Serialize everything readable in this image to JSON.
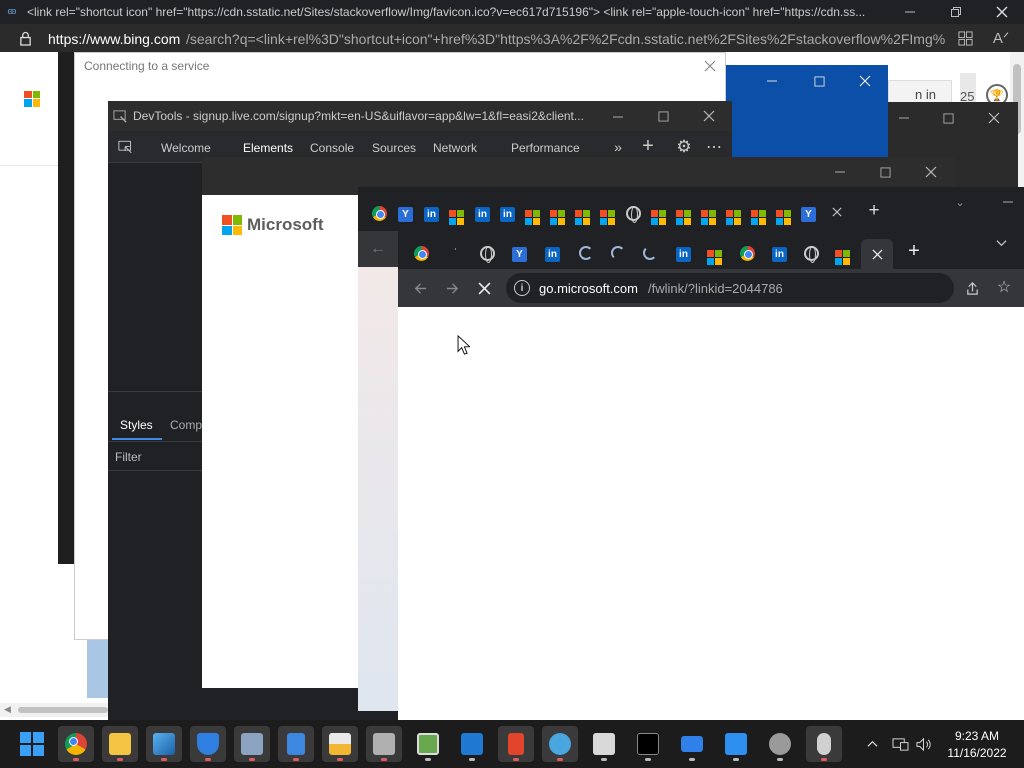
{
  "top_tab": {
    "title": "<link rel=\"shortcut icon\" href=\"https://cdn.sstatic.net/Sites/stackoverflow/Img/favicon.ico?v=ec617d715196\"> <link rel=\"apple-touch-icon\" href=\"https://cdn.ss..."
  },
  "top_address": {
    "host": "https://www.bing.com",
    "rest": "/search?q=<link+rel%3D\"shortcut+icon\"+href%3D\"https%3A%2F%2Fcdn.sstatic.net%2FSites%2Fstackoverflow%2FImg%..."
  },
  "bing_bg": {
    "signin_text": "n in",
    "count_text": "25"
  },
  "connecting_dialog": {
    "title": "Connecting to a service"
  },
  "devtools": {
    "title": "DevTools - signup.live.com/signup?mkt=en-US&uiflavor=app&lw=1&fl=easi2&client...",
    "tabs": [
      "Welcome",
      "Elements",
      "Console",
      "Sources",
      "Network",
      "Performance"
    ],
    "active_tab": "Elements",
    "panel_tabs": [
      "Styles",
      "Comp"
    ],
    "filter_placeholder": "Filter"
  },
  "signup_window": {
    "brand": "Microsoft"
  },
  "front_browser": {
    "address_host": "go.microsoft.com",
    "address_path": "/fwlink/?linkid=2044786"
  },
  "taskbar": {
    "time": "9:23 AM",
    "date": "11/16/2022",
    "icons": [
      "start-icon",
      "chrome-icon",
      "file-explorer-icon",
      "photos-icon",
      "security-shield-icon",
      "network-computer-icon",
      "notepad-icon",
      "file-folder-icon",
      "package-icon",
      "registry-icon",
      "monitor-app-icon",
      "office-icon",
      "globe-app-icon",
      "settings-app-icon",
      "terminal-icon",
      "mail-icon",
      "calendar-icon",
      "gear-icon",
      "mouse-icon"
    ]
  },
  "colors": {
    "taskbar_bg": "#1c1c1c",
    "devtools_bg": "#202124",
    "devtools_accent": "#3c8ce7",
    "blue_window": "#0b4fa8"
  }
}
